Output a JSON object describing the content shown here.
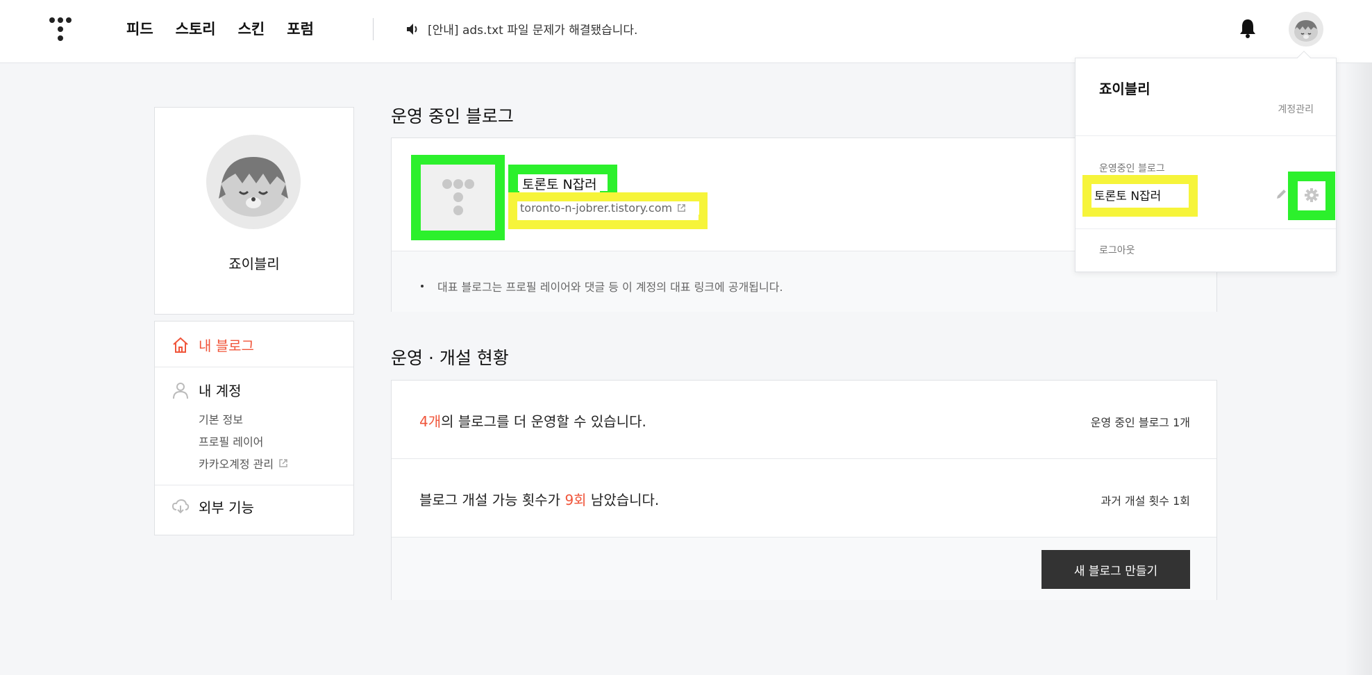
{
  "header": {
    "nav": [
      "피드",
      "스토리",
      "스킨",
      "포럼"
    ],
    "notice": "[안내] ads.txt 파일 문제가 해결됐습니다."
  },
  "profile": {
    "name": "죠이블리"
  },
  "sidebar": {
    "my_blog": "내 블로그",
    "my_account": "내 계정",
    "sub_items": [
      "기본 정보",
      "프로필 레이어",
      "카카오계정 관리"
    ],
    "external": "외부 기능"
  },
  "main": {
    "operating_title": "운영 중인 블로그",
    "blog_name": "토론토 N잡러",
    "blog_url": "toronto-n-jobrer.tistory.com",
    "note": "대표 블로그는 프로필 레이어와 댓글 등 이 계정의 대표 링크에 공개됩니다.",
    "status_title": "운영 · 개설 현황",
    "row1_highlight": "4개",
    "row1_rest": "의 블로그를 더 운영할 수 있습니다.",
    "row1_meta": "운영 중인 블로그 1개",
    "row2_pre": "블로그 개설 가능 횟수가 ",
    "row2_highlight": "9회",
    "row2_post": " 남았습니다.",
    "row2_meta": "과거 개설 횟수 1회",
    "new_blog_button": "새 블로그 만들기"
  },
  "dropdown": {
    "name": "죠이블리",
    "account_manage": "계정관리",
    "operating_label": "운영중인 블로그",
    "blog_name": "토론토 N잡러",
    "logout": "로그아웃"
  },
  "colors": {
    "accent_red": "#f0553a",
    "highlight_green": "#2cf02c",
    "highlight_yellow": "#f6f43a",
    "button_dark": "#333333"
  }
}
